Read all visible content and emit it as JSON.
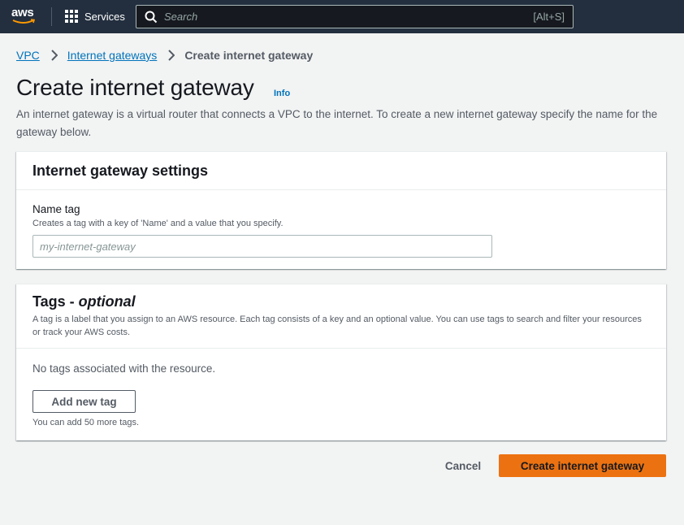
{
  "topnav": {
    "logo_text": "aws",
    "services_label": "Services",
    "search_placeholder": "Search",
    "search_shortcut": "[Alt+S]"
  },
  "breadcrumb": {
    "items": [
      "VPC",
      "Internet gateways"
    ],
    "current": "Create internet gateway"
  },
  "page": {
    "title": "Create internet gateway",
    "info_label": "Info",
    "description": "An internet gateway is a virtual router that connects a VPC to the internet. To create a new internet gateway specify the name for the gateway below."
  },
  "settings_panel": {
    "title": "Internet gateway settings",
    "name_tag_label": "Name tag",
    "name_tag_description": "Creates a tag with a key of 'Name' and a value that you specify.",
    "name_tag_placeholder": "my-internet-gateway",
    "name_tag_value": ""
  },
  "tags_panel": {
    "title_prefix": "Tags - ",
    "title_optional": "optional",
    "description": "A tag is a label that you assign to an AWS resource. Each tag consists of a key and an optional value. You can use tags to search and filter your resources or track your AWS costs.",
    "empty_text": "No tags associated with the resource.",
    "add_button_label": "Add new tag",
    "limit_text": "You can add 50 more tags."
  },
  "actions": {
    "cancel_label": "Cancel",
    "submit_label": "Create internet gateway"
  },
  "colors": {
    "nav_bg": "#232f3e",
    "link": "#0073bb",
    "primary": "#ec7211",
    "page_bg": "#f2f3f3",
    "logo_smile": "#ff9900"
  },
  "icons": [
    "aws-logo",
    "grid-icon",
    "search-icon",
    "chevron-right-icon"
  ]
}
